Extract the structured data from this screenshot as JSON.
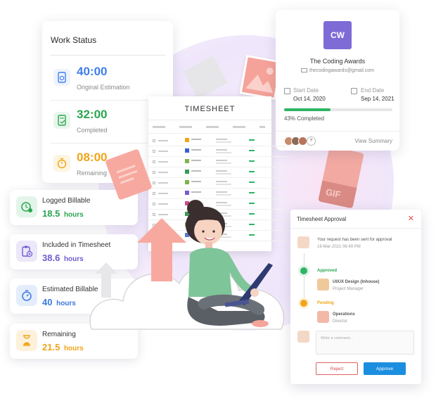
{
  "work_status": {
    "title": "Work Status",
    "items": [
      {
        "value": "40:00",
        "label": "Original Estimation",
        "color": "#3f7fea",
        "icon": "document-clock-icon"
      },
      {
        "value": "32:00",
        "label": "Completed",
        "color": "#2aa64f",
        "icon": "document-check-icon"
      },
      {
        "value": "08:00",
        "label": "Remaining",
        "color": "#f0a518",
        "icon": "timer-icon"
      }
    ]
  },
  "awards": {
    "logo": "CW",
    "name": "The Coding Awards",
    "email": "thecodingawards@gmail.com",
    "start_label": "Start Date",
    "start_date": "Oct 14, 2020",
    "end_label": "End Date",
    "end_date": "Sep 14, 2021",
    "progress": 0.43,
    "progress_label": "43% Completed",
    "view_summary": "View Summary"
  },
  "timesheet": {
    "title": "TIMESHEET"
  },
  "stats": [
    {
      "label": "Logged Billable",
      "value": "18.5",
      "unit": "hours",
      "color": "#2aa64f",
      "bg": "#e3f5e9",
      "icon": "clock-dollar-icon"
    },
    {
      "label": "Included in Timesheet",
      "value": "38.6",
      "unit": "hours",
      "color": "#6f5ad0",
      "bg": "#ece8fa",
      "icon": "clipboard-add-icon"
    },
    {
      "label": "Estimated Billable",
      "value": "40",
      "unit": "hours",
      "color": "#3a78e0",
      "bg": "#e4edfb",
      "icon": "stopwatch-icon"
    },
    {
      "label": "Remaining",
      "value": "21.5",
      "unit": "hours",
      "color": "#f0a518",
      "bg": "#fdf1dc",
      "icon": "hourglass-icon"
    }
  ],
  "approval": {
    "title": "Timesheet Approval",
    "close": "✕",
    "sent_message": "Your request has been sent for approval",
    "sent_time": "19-Mar-2021 06:49 PM",
    "approved_label": "Approved",
    "approved_dept": "UI/UX Design (Inhouse)",
    "approved_role": "Project Manager",
    "pending_label": "Pending",
    "pending_dept": "Operations",
    "pending_role": "Director",
    "comment_placeholder": "Write a comment...",
    "reject": "Reject",
    "approve": "Approve"
  }
}
